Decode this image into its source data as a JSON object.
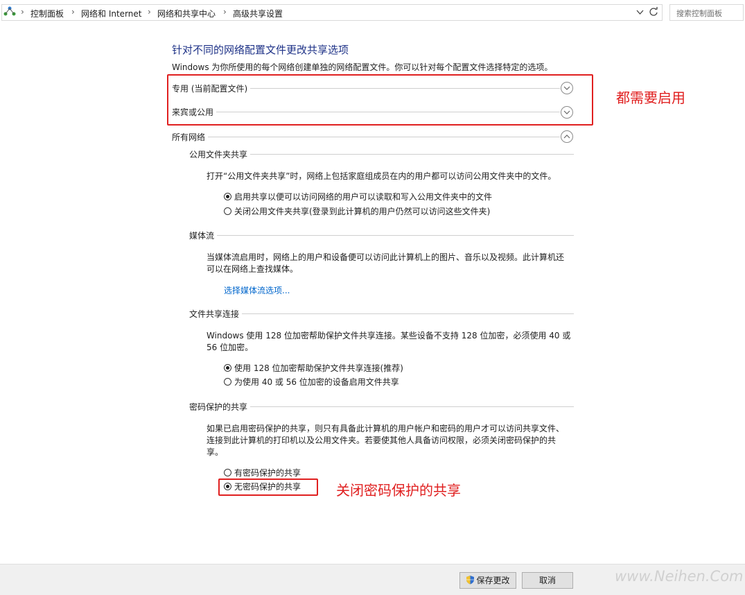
{
  "address_bar": {
    "breadcrumbs": [
      "控制面板",
      "网络和 Internet",
      "网络和共享中心",
      "高级共享设置"
    ],
    "search_placeholder": "搜索控制面板"
  },
  "page": {
    "heading": "针对不同的网络配置文件更改共享选项",
    "description": "Windows 为你所使用的每个网络创建单独的网络配置文件。你可以针对每个配置文件选择特定的选项。"
  },
  "profiles": [
    {
      "label": "专用 (当前配置文件)",
      "state": "collapsed"
    },
    {
      "label": "来宾或公用",
      "state": "collapsed"
    },
    {
      "label": "所有网络",
      "state": "expanded"
    }
  ],
  "sections": {
    "public_folder": {
      "title": "公用文件夹共享",
      "text": "打开“公用文件夹共享”时，网络上包括家庭组成员在内的用户都可以访问公用文件夹中的文件。",
      "options": [
        {
          "label": "启用共享以便可以访问网络的用户可以读取和写入公用文件夹中的文件",
          "selected": true
        },
        {
          "label": "关闭公用文件夹共享(登录到此计算机的用户仍然可以访问这些文件夹)",
          "selected": false
        }
      ]
    },
    "media": {
      "title": "媒体流",
      "text_line1": "当媒体流启用时，网络上的用户和设备便可以访问此计算机上的图片、音乐以及视频。此计算机还",
      "text_line2": "可以在网络上查找媒体。",
      "link": "选择媒体流选项..."
    },
    "file_sharing": {
      "title": "文件共享连接",
      "text_line1": "Windows 使用 128 位加密帮助保护文件共享连接。某些设备不支持 128 位加密，必须使用 40 或",
      "text_line2": "56 位加密。",
      "options": [
        {
          "label": "使用 128 位加密帮助保护文件共享连接(推荐)",
          "selected": true
        },
        {
          "label": "为使用 40 或 56 位加密的设备启用文件共享",
          "selected": false
        }
      ]
    },
    "password": {
      "title": "密码保护的共享",
      "text_line1": "如果已启用密码保护的共享，则只有具备此计算机的用户帐户和密码的用户才可以访问共享文件、",
      "text_line2": "连接到此计算机的打印机以及公用文件夹。若要使其他人具备访问权限，必须关闭密码保护的共",
      "text_line3": "享。",
      "options": [
        {
          "label": "有密码保护的共享",
          "selected": false
        },
        {
          "label": "无密码保护的共享",
          "selected": true
        }
      ]
    }
  },
  "annotations": {
    "profiles_note": "都需要启用",
    "password_note": "关闭密码保护的共享"
  },
  "footer": {
    "save_label": "保存更改",
    "cancel_label": "取消"
  },
  "watermark": "www.Neihen.Com",
  "colors": {
    "heading": "#1e3287",
    "link": "#0066cc",
    "annotation_red": "#e02020"
  }
}
